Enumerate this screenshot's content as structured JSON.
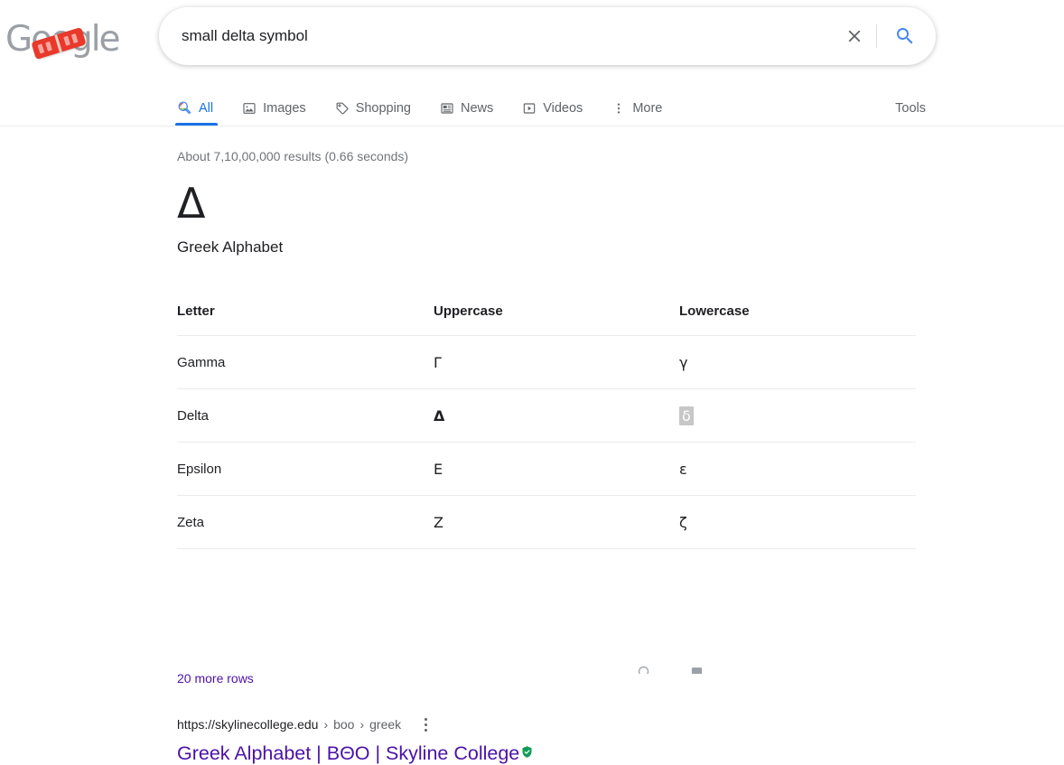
{
  "logo": {
    "text": "Google",
    "doodle": "red-capsule-doodle"
  },
  "search": {
    "query": "small delta symbol",
    "placeholder": "Search",
    "clear_icon": "close-icon",
    "search_icon": "search-icon",
    "accent_color": "#4285f4"
  },
  "nav": {
    "tabs": [
      {
        "label": "All",
        "icon": "google-search-icon",
        "active": true
      },
      {
        "label": "Images",
        "icon": "image-icon",
        "active": false
      },
      {
        "label": "Shopping",
        "icon": "tag-icon",
        "active": false
      },
      {
        "label": "News",
        "icon": "newspaper-icon",
        "active": false
      },
      {
        "label": "Videos",
        "icon": "video-play-icon",
        "active": false
      },
      {
        "label": "More",
        "icon": "kebab-menu-icon",
        "active": false
      }
    ],
    "tools_label": "Tools",
    "active_color": "#1a73e8"
  },
  "results": {
    "count_text": "About 7,10,00,000 results (0.66 seconds)"
  },
  "snippet": {
    "symbol": "Δ",
    "title": "Greek Alphabet",
    "table": {
      "headers": [
        "Letter",
        "Uppercase",
        "Lowercase"
      ],
      "rows": [
        {
          "letter": "Gamma",
          "uppercase": "Γ",
          "lowercase": "γ",
          "uppercase_bold": false,
          "lowercase_selected": false
        },
        {
          "letter": "Delta",
          "uppercase": "Δ",
          "lowercase": "δ",
          "uppercase_bold": true,
          "lowercase_selected": true
        },
        {
          "letter": "Epsilon",
          "uppercase": "Ε",
          "lowercase": "ε",
          "uppercase_bold": false,
          "lowercase_selected": false
        },
        {
          "letter": "Zeta",
          "uppercase": "Ζ",
          "lowercase": "ζ",
          "uppercase_bold": false,
          "lowercase_selected": false
        }
      ],
      "more_rows_label": "20 more rows",
      "link_color": "#4b11a8"
    }
  },
  "organic_result": {
    "url_base": "https://skylinecollege.edu",
    "crumb_1": "boo",
    "crumb_2": "greek",
    "crumb_separator": "›",
    "kebab_icon": "kebab-menu-icon",
    "title": "Greek Alphabet | ΒΘΟ | Skyline College",
    "badge_icon": "verified-shield-icon",
    "badge_color": "#0f9d58",
    "title_color": "#4b11a8"
  },
  "footer": {
    "items": [
      {
        "label": "",
        "icon": "location-icon"
      },
      {
        "label": "",
        "icon": "feedback-icon"
      }
    ]
  }
}
